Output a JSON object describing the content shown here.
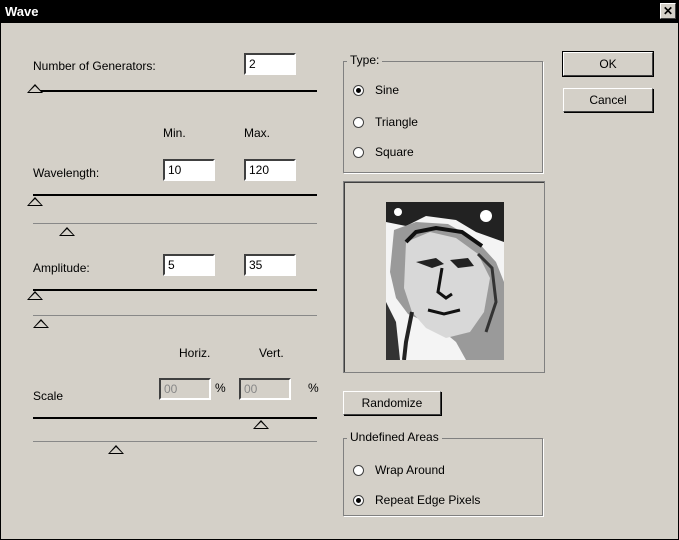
{
  "window": {
    "title": "Wave",
    "close_glyph": "✕"
  },
  "generators": {
    "label": "Number of Generators:",
    "value": "2"
  },
  "minmax": {
    "min_label": "Min.",
    "max_label": "Max."
  },
  "wavelength": {
    "label": "Wavelength:",
    "min": "10",
    "max": "120"
  },
  "amplitude": {
    "label": "Amplitude:",
    "min": "5",
    "max": "35"
  },
  "scale": {
    "horiz_label": "Horiz.",
    "vert_label": "Vert.",
    "label": "Scale",
    "horiz": "00",
    "vert": "00",
    "unit": "%"
  },
  "type_group": {
    "title": "Type:",
    "options": [
      {
        "label": "Sine",
        "checked": true
      },
      {
        "label": "Triangle",
        "checked": false
      },
      {
        "label": "Square",
        "checked": false
      }
    ]
  },
  "buttons": {
    "ok": "OK",
    "cancel": "Cancel",
    "randomize": "Randomize"
  },
  "undefined_areas": {
    "title": "Undefined Areas",
    "options": [
      {
        "label": "Wrap Around",
        "checked": false
      },
      {
        "label": "Repeat Edge Pixels",
        "checked": true
      }
    ]
  },
  "preview": {
    "icon": "statue-face-preview"
  }
}
